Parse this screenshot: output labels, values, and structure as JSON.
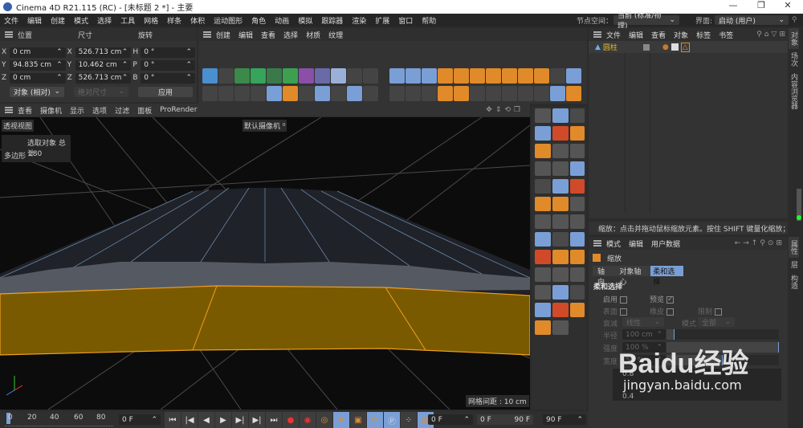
{
  "window": {
    "title": "Cinema 4D R21.115 (RC) - [未标题 2 *] - 主要",
    "minimize": "—",
    "restore": "❐",
    "close": "✕"
  },
  "menu": [
    "文件",
    "编辑",
    "创建",
    "模式",
    "选择",
    "工具",
    "网格",
    "样条",
    "体积",
    "运动图形",
    "角色",
    "动画",
    "模拟",
    "跟踪器",
    "渲染",
    "扩展",
    "窗口",
    "帮助"
  ],
  "node_space": {
    "label": "节点空间：",
    "value": "当前 (标准/物理)"
  },
  "layout": {
    "label": "界面:",
    "value": "启动 (用户)"
  },
  "coords": {
    "headers": [
      "位置",
      "尺寸",
      "旋转"
    ],
    "rows": [
      {
        "axis": "X",
        "pos": "0 cm",
        "size_axis": "X",
        "size": "526.713 cm",
        "rot_axis": "H",
        "rot": "0 °"
      },
      {
        "axis": "Y",
        "pos": "94.835 cm",
        "size_axis": "Y",
        "size": "10.462 cm",
        "rot_axis": "P",
        "rot": "0 °"
      },
      {
        "axis": "Z",
        "pos": "0 cm",
        "size_axis": "Z",
        "size": "526.713 cm",
        "rot_axis": "B",
        "rot": "0 °"
      }
    ],
    "mode": "对象 (相对)",
    "size_mode": "绝对尺寸",
    "apply": "应用"
  },
  "toolbar_menu": [
    "创建",
    "编辑",
    "查看",
    "选择",
    "材质",
    "纹理"
  ],
  "object_manager": {
    "menu": [
      "文件",
      "编辑",
      "查看",
      "对象",
      "标签",
      "书签"
    ],
    "object": "圆柱"
  },
  "right_tabs_top": [
    "对象",
    "场次",
    "内容浏览器"
  ],
  "right_tabs_bottom": [
    "属性",
    "层",
    "构造"
  ],
  "viewport": {
    "menu": [
      "查看",
      "摄像机",
      "显示",
      "选项",
      "过滤",
      "面板",
      "ProRender"
    ],
    "name": "透视视图",
    "camera": "默认摄像机",
    "stats_header": "选取对象 总计",
    "stats_label": "多边形",
    "stats_value": "180",
    "grid": "网格间距 : 10 cm"
  },
  "status": "缩放：点击并拖动鼠标缩放元素。按住 SHIFT 键量化缩放；节点编辑",
  "attributes": {
    "menu": [
      "模式",
      "编辑",
      "用户数据"
    ],
    "title": "缩放",
    "tabs": [
      "轴向",
      "对象轴心",
      "柔和选择"
    ],
    "section": "柔和选择",
    "enable": "启用",
    "preview": "预览",
    "surface": "表面",
    "rubber": "橡皮",
    "limit": "限制",
    "falloff_label": "衰减",
    "falloff": "线性",
    "mode_label": "模式",
    "mode": "全部",
    "radius_label": "半径",
    "radius": "100 cm",
    "strength_label": "强度",
    "strength": "100 %",
    "width_label": "宽度",
    "width": "50 %",
    "graph_tick": "0.8",
    "graph_tick2": "0.4"
  },
  "timeline": {
    "ticks": [
      "0",
      "20",
      "40",
      "60",
      "80"
    ],
    "current": "0 F",
    "start": "0 F",
    "range_start": "0 F",
    "range_end": "90 F",
    "end": "90 F"
  },
  "watermark": {
    "brand": "Baidu经验",
    "url": "jingyan.baidu.com"
  }
}
